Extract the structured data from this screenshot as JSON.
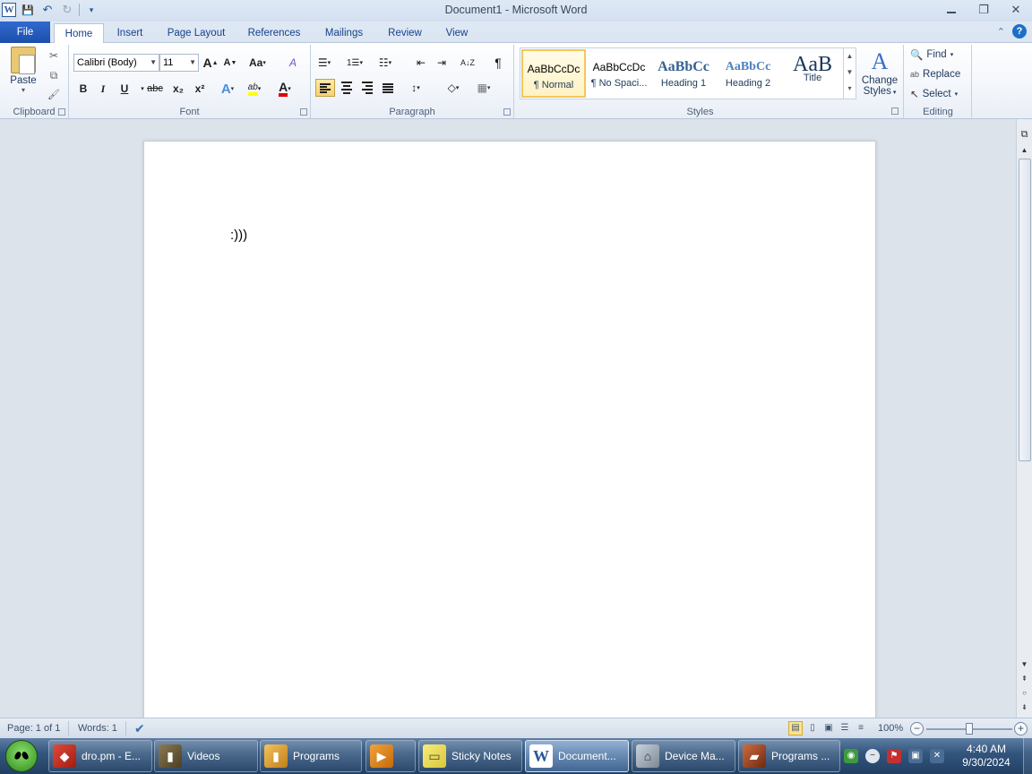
{
  "window": {
    "title": "Document1  -  Microsoft Word",
    "app_icon_letter": "W",
    "controls": {
      "minimize": "▭",
      "restore": "❐",
      "close": "✕"
    }
  },
  "quick_access": {
    "save": "💾",
    "undo": "↶",
    "redo": "↻"
  },
  "tabs": [
    {
      "label": "File"
    },
    {
      "label": "Home"
    },
    {
      "label": "Insert"
    },
    {
      "label": "Page Layout"
    },
    {
      "label": "References"
    },
    {
      "label": "Mailings"
    },
    {
      "label": "Review"
    },
    {
      "label": "View"
    }
  ],
  "help": {
    "label": "?"
  },
  "ribbon": {
    "clipboard": {
      "label": "Clipboard",
      "paste_label": "Paste",
      "cut": "✂",
      "copy": "⧉",
      "format_painter": "🖌"
    },
    "font": {
      "label": "Font",
      "font_name": "Calibri (Body)",
      "font_size": "11",
      "grow": "A",
      "shrink": "A",
      "change_case": "Aa",
      "clear_format": "A",
      "bold": "B",
      "italic": "I",
      "underline": "U",
      "strike": "abc",
      "subscript": "x₂",
      "superscript": "x²",
      "text_effects": "A",
      "highlight": "ab",
      "font_color": "A"
    },
    "paragraph": {
      "label": "Paragraph",
      "bullets": "☰",
      "numbering": "1☰",
      "multilevel": "☷",
      "decrease_indent": "⇤",
      "increase_indent": "⇥",
      "sort": "A↓Z",
      "pilcrow": "¶",
      "align_left": "≡",
      "center": "≡",
      "align_right": "≡",
      "justify": "≡",
      "line_spacing": "↕",
      "shading": "◇",
      "borders": "▦"
    },
    "styles": {
      "label": "Styles",
      "items": [
        {
          "sample": "AaBbCcDc",
          "name": "¶ Normal"
        },
        {
          "sample": "AaBbCcDc",
          "name": "¶ No Spaci..."
        },
        {
          "sample": "AaBbCc",
          "name": "Heading 1"
        },
        {
          "sample": "AaBbCc",
          "name": "Heading 2"
        },
        {
          "sample": "AaB",
          "name": "Title"
        }
      ],
      "change_styles_line1": "Change",
      "change_styles_line2": "Styles"
    },
    "editing": {
      "label": "Editing",
      "find": "Find",
      "replace": "Replace",
      "select": "Select"
    }
  },
  "document": {
    "body_text": ":)))"
  },
  "status": {
    "page": "Page: 1 of 1",
    "words": "Words: 1",
    "zoom": "100%"
  },
  "taskbar": {
    "items": [
      {
        "label": "dro.pm - E..."
      },
      {
        "label": "Videos"
      },
      {
        "label": "Programs"
      },
      {
        "label": ""
      },
      {
        "label": "Sticky Notes"
      },
      {
        "label": "Document..."
      },
      {
        "label": "Device Ma..."
      },
      {
        "label": "Programs ..."
      }
    ],
    "clock_time": "4:40 AM",
    "clock_date": "9/30/2024"
  },
  "colors": {
    "file_tab": "#2b5fc0",
    "word_blue": "#2b579a",
    "highlight_yellow": "#ffff00",
    "font_red": "#e00000",
    "taskbar": "#2d4f78"
  }
}
